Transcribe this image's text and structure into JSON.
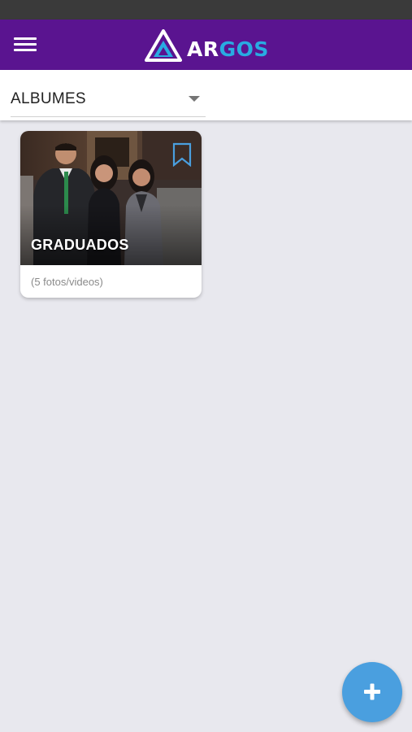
{
  "app": {
    "logo_text_1": "AR",
    "logo_text_2": "GOS"
  },
  "filter": {
    "selected": "ALBUMES"
  },
  "albums": [
    {
      "title": "GRADUADOS",
      "count": "(5 fotos/videos)"
    }
  ],
  "colors": {
    "app_bar": "#5a1490",
    "logo_accent": "#29abe2",
    "fab": "#4a9fdf",
    "background": "#e8e8ee"
  },
  "icons": {
    "menu": "menu-icon",
    "dropdown": "chevron-down-icon",
    "bookmark": "bookmark-icon",
    "add": "plus-icon"
  }
}
